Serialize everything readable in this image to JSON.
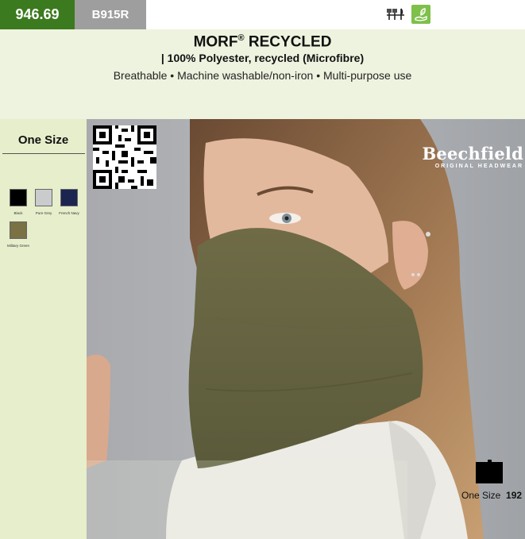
{
  "top_bar": {
    "article_no": "946.69",
    "code": "B915R",
    "icons": [
      "fork-knife-icon",
      "eco-hand-leaf-icon"
    ]
  },
  "header": {
    "title": "MORF",
    "title_mark": "®",
    "title_rest": " RECYCLED",
    "subtitle": "| 100% Polyester, recycled (Microfibre)",
    "features": "Breathable • Machine washable/non-iron • Multi-purpose use"
  },
  "sizes": {
    "heading": "One Size"
  },
  "colors": [
    {
      "name": "Black",
      "hex": "#000000"
    },
    {
      "name": "Pure Grey",
      "hex": "#c9cbcd"
    },
    {
      "name": "French Navy",
      "hex": "#1c2450"
    },
    {
      "name": "Military Green",
      "hex": "#7a7145"
    }
  ],
  "brand": {
    "name": "Beechfield",
    "tagline": "ORIGINAL HEADWEAR"
  },
  "packaging": {
    "size_label": "One Size",
    "quantity": "192"
  },
  "palette": {
    "accent_green": "#3c7a1f",
    "header_bg": "#eef3df",
    "sidebar_bg": "#e6eecb",
    "code_grey": "#9e9e9e"
  }
}
